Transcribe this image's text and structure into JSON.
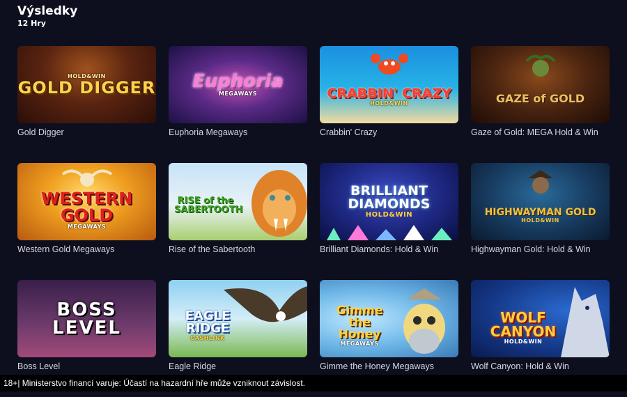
{
  "header": {
    "title": "Výsledky",
    "count": "12 Hry"
  },
  "games": [
    {
      "name": "Gold Digger",
      "logo": "GOLD DIGGER",
      "sub": "HOLD&WIN"
    },
    {
      "name": "Euphoria Megaways",
      "logo": "Euphoria",
      "sub": "MEGAWAYS"
    },
    {
      "name": "Crabbin' Crazy",
      "logo": "CRABBIN' CRAZY",
      "sub": "HOLD&WIN"
    },
    {
      "name": "Gaze of Gold: MEGA Hold & Win",
      "logo": "GAZE of GOLD",
      "sub": ""
    },
    {
      "name": "Western Gold Megaways",
      "logo": "WESTERN GOLD",
      "sub": "MEGAWAYS"
    },
    {
      "name": "Rise of the Sabertooth",
      "logo": "RISE of the SABERTOOTH",
      "sub": ""
    },
    {
      "name": "Brilliant Diamonds: Hold & Win",
      "logo": "BRILLIANT DIAMONDS",
      "sub": "HOLD&WIN"
    },
    {
      "name": "Highwayman Gold: Hold & Win",
      "logo": "HIGHWAYMAN GOLD",
      "sub": "HOLD&WIN"
    },
    {
      "name": "Boss Level",
      "logo": "BOSS LEVEL",
      "sub": ""
    },
    {
      "name": "Eagle Ridge",
      "logo": "EAGLE RIDGE",
      "sub": "CASHLINK"
    },
    {
      "name": "Gimme the Honey Megaways",
      "logo": "Gimme the Honey",
      "sub": "MEGAWAYS"
    },
    {
      "name": "Wolf Canyon: Hold & Win",
      "logo": "WOLF CANYON",
      "sub": "HOLD&WIN"
    }
  ],
  "footer": {
    "text": "18+| Ministerstvo financí varuje: Účastí na hazardní hře může vzniknout závislost."
  }
}
